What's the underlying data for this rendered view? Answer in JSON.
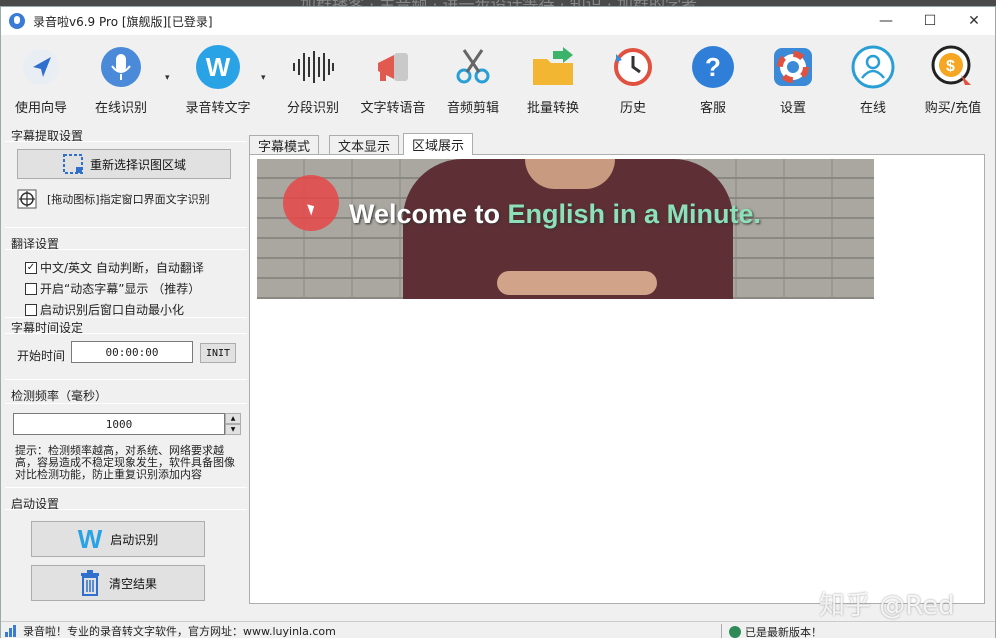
{
  "background_window": {
    "text": "加群播客 · 主音频 · 进一步设计等待 · 知识 · 加群的学者"
  },
  "window": {
    "title": "录音啦v6.9 Pro [旗舰版][已登录]",
    "minimize": "—",
    "maximize": "☐",
    "close": "✕"
  },
  "toolbar": {
    "items": [
      {
        "label": "使用向导",
        "icon": "navigation-arrow-icon"
      },
      {
        "label": "在线识别",
        "icon": "microphone-icon"
      },
      {
        "label": "录音转文字",
        "icon": "w-logo-icon"
      },
      {
        "label": "分段识别",
        "icon": "waveform-icon"
      },
      {
        "label": "文字转语音",
        "icon": "megaphone-icon"
      },
      {
        "label": "音频剪辑",
        "icon": "scissors-icon"
      },
      {
        "label": "批量转换",
        "icon": "folder-arrow-icon"
      },
      {
        "label": "历史",
        "icon": "history-clock-icon"
      },
      {
        "label": "客服",
        "icon": "help-question-icon"
      },
      {
        "label": "设置",
        "icon": "lifebuoy-icon"
      },
      {
        "label": "在线",
        "icon": "user-online-icon"
      },
      {
        "label": "购买/充值",
        "icon": "purchase-coin-icon"
      }
    ],
    "dropdown_glyph": "▾"
  },
  "subtitle_extract": {
    "title": "字幕提取设置",
    "reselect_button": "重新选择识图区域",
    "drag_hint": "[拖动图标]指定窗口界面文字识别"
  },
  "translate": {
    "title": "翻译设置",
    "options": [
      {
        "label": "中文/英文 自动判断，自动翻译",
        "checked": true
      },
      {
        "label": "开启“动态字幕”显示  （推荐）",
        "checked": false
      },
      {
        "label": "启动识别后窗口自动最小化",
        "checked": false
      }
    ],
    "check_glyph": "✓"
  },
  "subtitle_time": {
    "title": "字幕时间设定",
    "start_label": "开始时间",
    "start_value": "00:00:00",
    "init_button": "INIT"
  },
  "detect_rate": {
    "title": "检测频率（毫秒）",
    "value": "1000",
    "up": "▲",
    "down": "▼",
    "hint": "提示：检测频率越高，对系统、网络要求越高，容易造成不稳定现象发生，软件具备图像对比检测功能，防止重复识别添加内容"
  },
  "startup": {
    "title": "启动设置",
    "start_button": "启动识别",
    "clear_button": "清空结果"
  },
  "tabs": [
    {
      "label": "字幕模式",
      "active": false
    },
    {
      "label": "文本显示",
      "active": false
    },
    {
      "label": "区域展示",
      "active": true
    }
  ],
  "video": {
    "caption_plain": "Welcome to ",
    "caption_highlight": "English in a Minute."
  },
  "watermark": "知乎 @Red",
  "status": {
    "left_text": "录音啦！专业的录音转文字软件，官方网址：www.luyinla.com",
    "right_text": "已是最新版本！"
  },
  "colors": {
    "accent": "#3a7bd5",
    "caption_highlight": "#8ee0b8",
    "cursor_dot": "#e64646"
  }
}
